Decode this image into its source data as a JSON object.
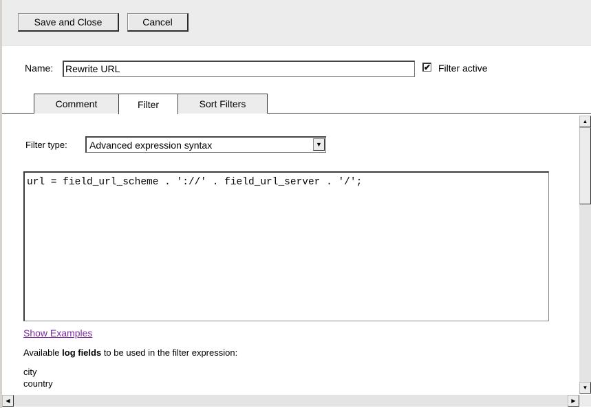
{
  "toolbar": {
    "save_close_label": "Save and Close",
    "cancel_label": "Cancel"
  },
  "form": {
    "name_label": "Name:",
    "name_value": "Rewrite URL",
    "filter_active_checked": true,
    "filter_active_label": "Filter active"
  },
  "tabs": [
    {
      "label": "Comment",
      "active": false
    },
    {
      "label": "Filter",
      "active": true
    },
    {
      "label": "Sort Filters",
      "active": false
    }
  ],
  "filter": {
    "type_label": "Filter type:",
    "type_value": "Advanced expression syntax",
    "expression": "url = field_url_scheme . '://' . field_url_server . '/';",
    "show_examples_label": "Show Examples",
    "help_prefix": "Available ",
    "help_bold": "log fields",
    "help_suffix": " to be used in the filter expression:",
    "log_fields": [
      "city",
      "country"
    ]
  },
  "icons": {
    "check": "✔",
    "dropdown": "▼",
    "scroll_up": "▲",
    "scroll_down": "▼",
    "scroll_left": "◀",
    "scroll_right": "▶"
  }
}
